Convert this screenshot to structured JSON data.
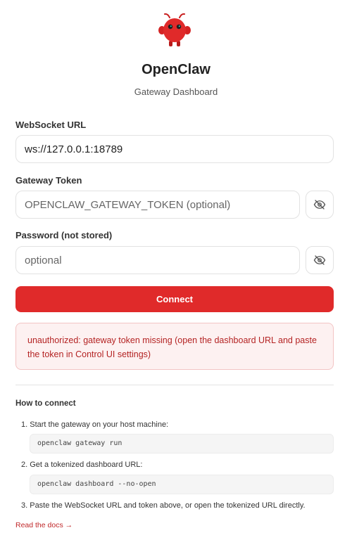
{
  "app": {
    "title": "OpenClaw",
    "subtitle": "Gateway Dashboard"
  },
  "form": {
    "websocket_label": "WebSocket URL",
    "websocket_value": "ws://127.0.0.1:18789",
    "token_label": "Gateway Token",
    "token_placeholder": "OPENCLAW_GATEWAY_TOKEN (optional)",
    "password_label": "Password (not stored)",
    "password_placeholder": "optional",
    "connect_label": "Connect"
  },
  "error": {
    "message": "unauthorized: gateway token missing (open the dashboard URL and paste the token in Control UI settings)"
  },
  "howto": {
    "title": "How to connect",
    "step1": "1. Start the gateway on your host machine:",
    "code1": "openclaw gateway run",
    "step2": "2. Get a tokenized dashboard URL:",
    "code2": "openclaw dashboard --no-open",
    "step3": "3. Paste the WebSocket URL and token above, or open the tokenized URL directly.",
    "docs_link": "Read the docs →"
  },
  "colors": {
    "accent": "#e02a2a",
    "error_text": "#b42323",
    "error_bg": "#fdf1f1"
  },
  "icons": {
    "logo": "red-claw-mascot-icon",
    "toggle": "eye-off-icon"
  }
}
